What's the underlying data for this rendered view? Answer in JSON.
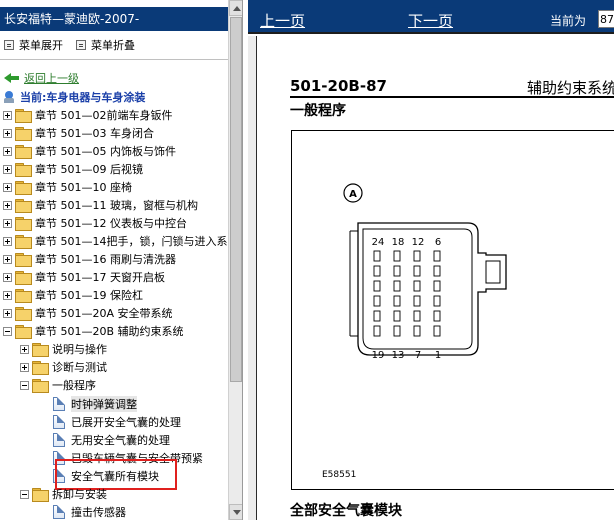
{
  "left_pane": {
    "title": "长安福特—蒙迪欧-2007-",
    "expand_label": "菜单展开",
    "collapse_label": "菜单折叠",
    "back_label": "返回上一级",
    "current_label": "当前:车身电器与车身涂装",
    "tree": [
      {
        "label": "章节 501—02前端车身钣件",
        "expanded": false
      },
      {
        "label": "章节 501—03 车身闭合",
        "expanded": false
      },
      {
        "label": "章节 501—05 内饰板与饰件",
        "expanded": false
      },
      {
        "label": "章节 501—09 后视镜",
        "expanded": false
      },
      {
        "label": "章节 501—10 座椅",
        "expanded": false
      },
      {
        "label": "章节 501—11 玻璃，窗框与机构",
        "expanded": false
      },
      {
        "label": "章节 501—12 仪表板与中控台",
        "expanded": false
      },
      {
        "label": "章节 501—14把手，锁，闩锁与进入系",
        "expanded": false
      },
      {
        "label": "章节 501—16 雨刷与清洗器",
        "expanded": false
      },
      {
        "label": "章节 501—17 天窗开启板",
        "expanded": false
      },
      {
        "label": "章节 501—19 保险杠",
        "expanded": false
      },
      {
        "label": "章节 501—20A 安全带系统",
        "expanded": false
      },
      {
        "label": "章节 501—20B 辅助约束系统",
        "expanded": true
      }
    ],
    "subtree": [
      {
        "label": "说明与操作",
        "expanded": false
      },
      {
        "label": "诊断与测试",
        "expanded": false
      },
      {
        "label": "一般程序",
        "expanded": true
      }
    ],
    "documents": [
      {
        "label": "时钟弹簧调整",
        "selected": true
      },
      {
        "label": "已展开安全气囊的处理",
        "selected": false
      },
      {
        "label": "无用安全气囊的处理",
        "selected": false
      },
      {
        "label": "已毁车辆气囊与安全带预紧",
        "selected": false
      },
      {
        "label": "安全气囊所有模块",
        "selected": false
      }
    ],
    "after": [
      {
        "label": "拆卸与安装",
        "expanded": true
      }
    ],
    "after_docs": [
      {
        "label": "撞击传感器"
      }
    ]
  },
  "top_nav": {
    "prev_label": "上一页",
    "next_label": "下一页",
    "current_page_label": "当前为",
    "current_page_value": "87"
  },
  "document": {
    "code": "501-20B-87",
    "system": "辅助约束系统",
    "subtitle": "一般程序",
    "figure_label": "A",
    "pin_labels_top": [
      "24",
      "18",
      "12",
      "6"
    ],
    "pin_labels_bottom": [
      "19",
      "13",
      "7",
      "1"
    ],
    "figure_code": "E58551",
    "section_title": "全部安全气囊模块"
  },
  "colors": {
    "header_bg": "#0a3a78",
    "highlight": "#e0201e",
    "link_green": "#2e7d2e",
    "current_blue": "#1a3fa8"
  }
}
